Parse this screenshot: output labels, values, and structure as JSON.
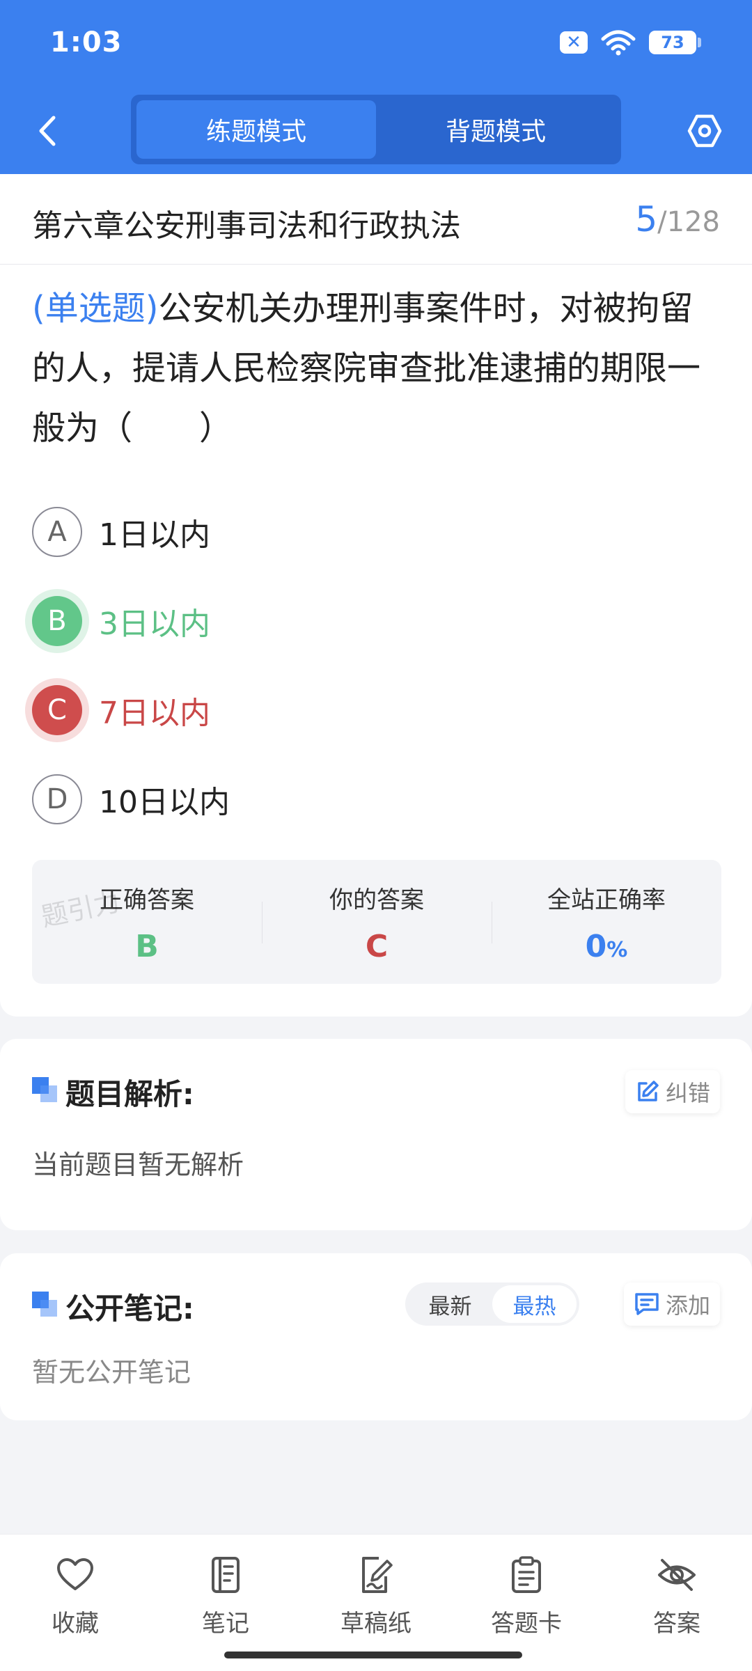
{
  "status_bar": {
    "time": "1:03",
    "battery": "73"
  },
  "nav": {
    "modes": [
      "练题模式",
      "背题模式"
    ],
    "active_mode": "练题模式"
  },
  "chapter": {
    "title": "第六章公安刑事司法和行政执法",
    "current": "5",
    "total": "/128"
  },
  "question": {
    "type_label": "(单选题)",
    "text": "公安机关办理刑事案件时，对被拘留的人，提请人民检察院审查批准逮捕的期限一般为（　　）",
    "options": [
      {
        "letter": "A",
        "text": "1日以内",
        "state": "normal"
      },
      {
        "letter": "B",
        "text": "3日以内",
        "state": "correct"
      },
      {
        "letter": "C",
        "text": "7日以内",
        "state": "wrong"
      },
      {
        "letter": "D",
        "text": "10日以内",
        "state": "normal"
      }
    ]
  },
  "answer": {
    "correct_label": "正确答案",
    "correct_value": "B",
    "yours_label": "你的答案",
    "yours_value": "C",
    "rate_label": "全站正确率",
    "rate_value": "0",
    "rate_unit": "%",
    "watermark": "题引力"
  },
  "analysis": {
    "title": "题目解析:",
    "correct_btn": "纠错",
    "empty_text": "当前题目暂无解析"
  },
  "notes": {
    "title": "公开笔记:",
    "sort_options": [
      "最新",
      "最热"
    ],
    "active_sort": "最热",
    "add_btn": "添加",
    "empty_text": "暂无公开笔记"
  },
  "bottom_tabs": [
    {
      "label": "收藏",
      "icon": "heart-icon"
    },
    {
      "label": "笔记",
      "icon": "notebook-icon"
    },
    {
      "label": "草稿纸",
      "icon": "draft-paper-icon"
    },
    {
      "label": "答题卡",
      "icon": "answer-card-icon"
    },
    {
      "label": "答案",
      "icon": "eye-off-icon"
    }
  ],
  "colors": {
    "brand": "#3b80ef",
    "correct": "#5cc085",
    "wrong": "#c94747"
  }
}
